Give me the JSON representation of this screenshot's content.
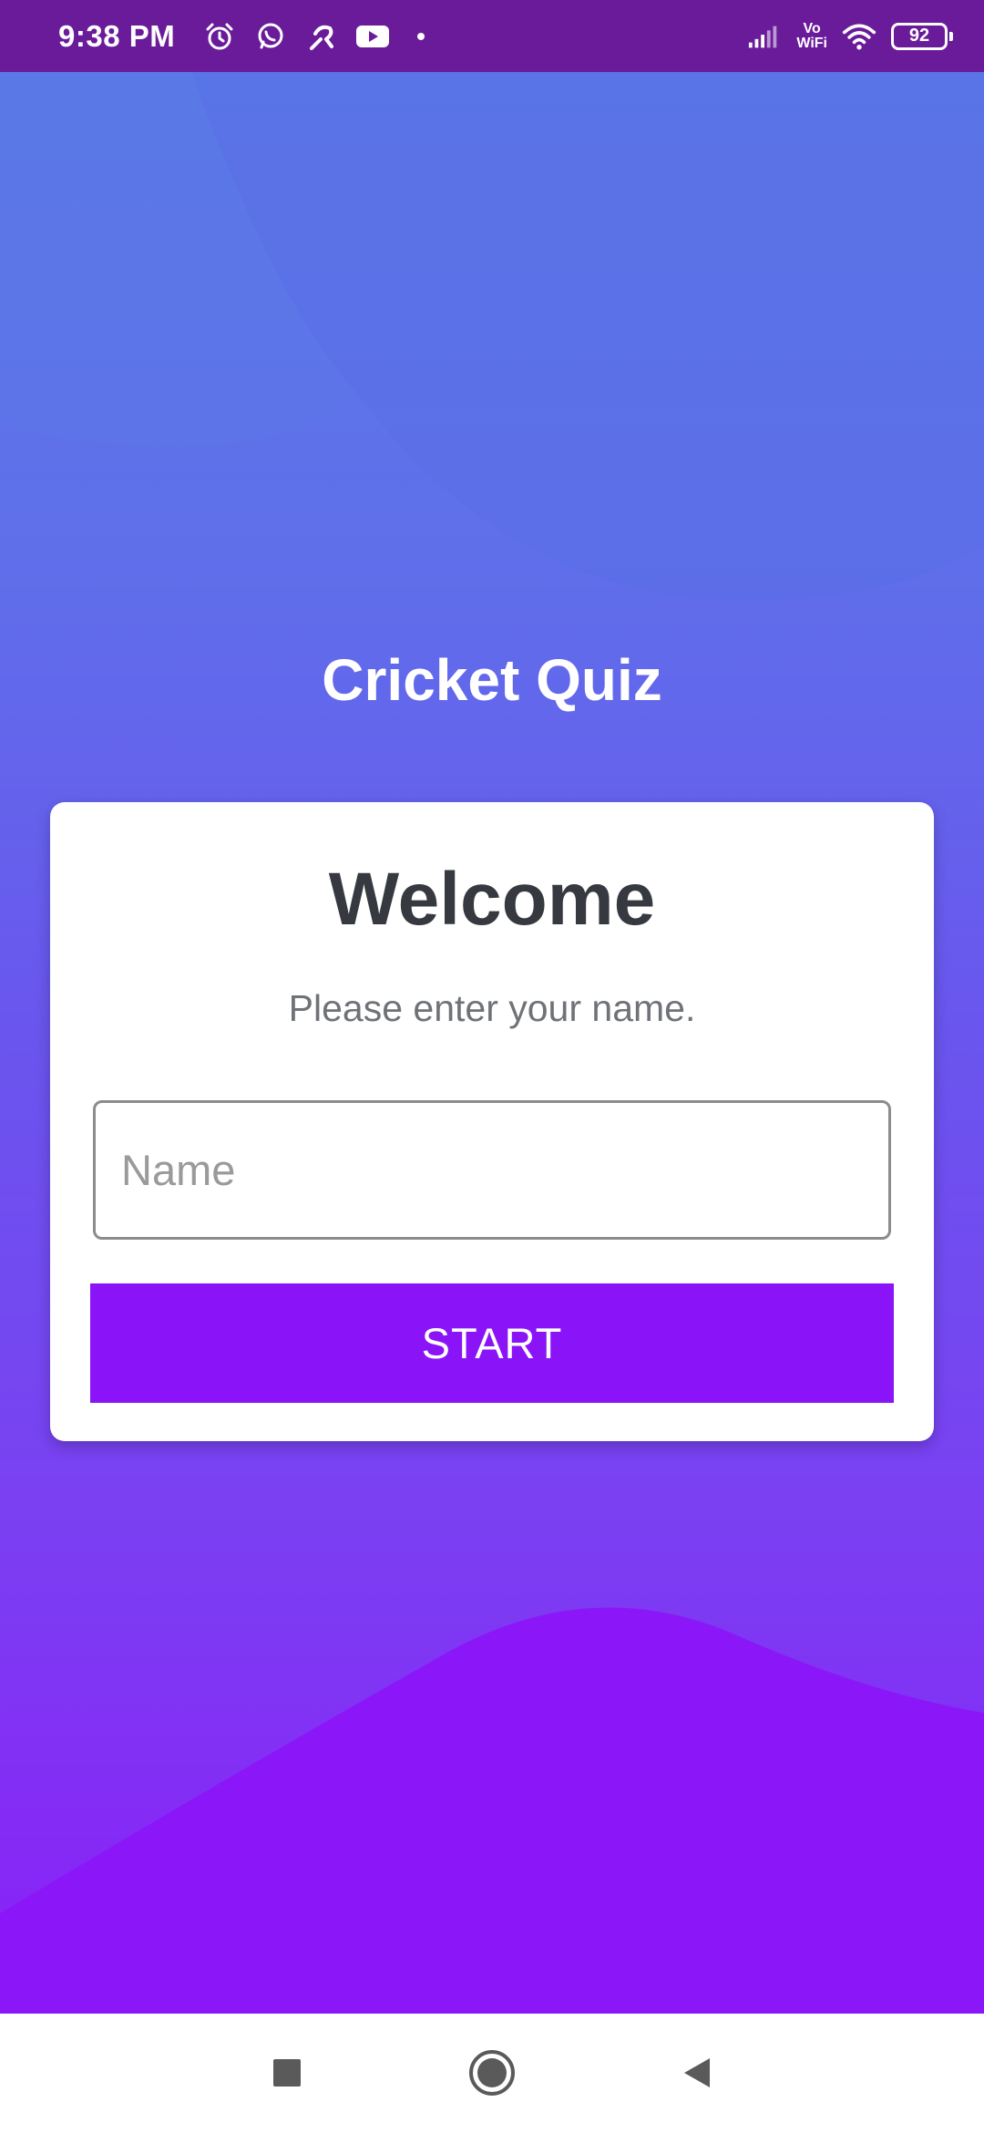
{
  "status_bar": {
    "time": "9:38 PM",
    "left_icons": [
      "alarm-icon",
      "whatsapp-icon",
      "signal-app-icon",
      "youtube-icon"
    ],
    "right_icons": [
      "cellular-signal-icon",
      "vowifi-icon",
      "wifi-icon",
      "battery-icon"
    ],
    "vowifi_top": "Vo",
    "vowifi_bottom": "WiFi",
    "battery_level": "92"
  },
  "app": {
    "title": "Cricket Quiz"
  },
  "card": {
    "title": "Welcome",
    "subtitle": "Please enter your name.",
    "name_input": {
      "value": "",
      "placeholder": "Name"
    },
    "start_label": "START"
  },
  "nav_bar": {
    "icons": [
      "recent-apps-icon",
      "home-icon",
      "back-icon"
    ]
  },
  "colors": {
    "status_bar": "#6a1b9a",
    "gradient_top": "#5a78e6",
    "gradient_bottom": "#8a1ff7",
    "start_button": "#8a14f7",
    "card_background": "#ffffff"
  }
}
